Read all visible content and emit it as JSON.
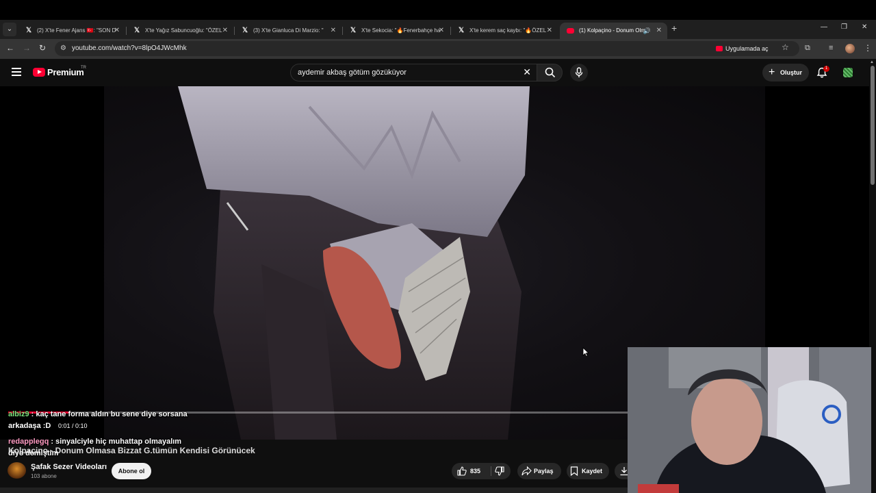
{
  "browser": {
    "tabs": [
      {
        "title": "(2) X'te Fener Ajans 🇹🇷: \"SON D",
        "icon": "x-logo-icon"
      },
      {
        "title": "X'te Yağız Sabuncuoğlu: \"ÖZEL",
        "icon": "x-logo-icon"
      },
      {
        "title": "(3) X'te Gianluca Di Marzio: \"",
        "icon": "x-logo-icon"
      },
      {
        "title": "X'te Sekocia: \"🔥Fenerbahçe ha",
        "icon": "x-logo-icon"
      },
      {
        "title": "X'te kerem saç kaybı: \"🔥ÖZEL",
        "icon": "x-logo-icon"
      },
      {
        "title": "(1) Kolpaçino - Donum Olm",
        "icon": "youtube-icon",
        "active": true
      }
    ],
    "url": "youtube.com/watch?v=8lpO4JWcMhk",
    "open_in_app": "Uygulamada aç"
  },
  "youtube": {
    "brand": "Premium",
    "region": "TR",
    "search_query": "aydemir akbaş götüm gözüküyor",
    "create_label": "Oluştur",
    "notification_count": "1"
  },
  "player": {
    "time": "0:01 / 0:10",
    "progress_fraction": 0.1
  },
  "chat": [
    {
      "user": "albiz9",
      "message": "kaç tane forma aldın bu sene diye sorsana",
      "cont": "arkadaşa :D"
    },
    {
      "user": "redapplegq",
      "message": "sinyalciyle hiç muhattap olmayalım",
      "cont": "diye demiştim"
    }
  ],
  "video": {
    "title": "Kolpaçino - Donum Olmasa Bizzat G.tümün Kendisi Görünücek",
    "channel": "Şafak Sezer Videoları",
    "subscribers": "103 abone",
    "subscribe_label": "Abone ol",
    "likes": "835",
    "share_label": "Paylaş",
    "save_label": "Kaydet"
  },
  "colors": {
    "accent": "#ff0033",
    "background": "#0f0f0f",
    "chat_user1": "#7ee37e",
    "chat_user2": "#ff9ac2"
  }
}
